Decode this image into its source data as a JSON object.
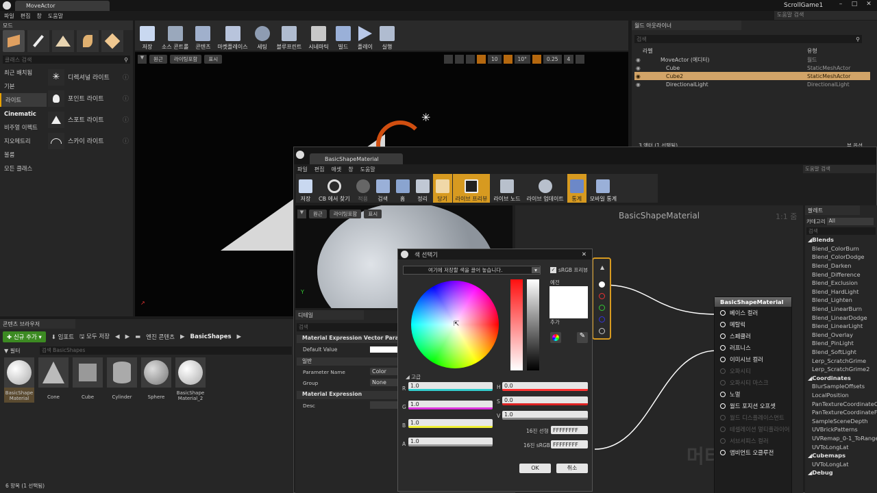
{
  "main": {
    "tab": "MoveActor",
    "project": "ScrollGame1",
    "help_search": "도움말 검색",
    "menu": [
      "파일",
      "편집",
      "창",
      "도움말"
    ],
    "toolbar": [
      "저장",
      "소스 콘트롤",
      "콘텐츠",
      "마켓플레이스",
      "세팅",
      "블루프린트",
      "시네마틱",
      "빌드",
      "플레이",
      "실행"
    ],
    "viewport_buttons": [
      "원근",
      "라이팅포함",
      "표시"
    ],
    "snap": {
      "grid": "10",
      "rot": "10°",
      "scale": "0.25",
      "cam": "4"
    }
  },
  "modes": {
    "title": "모드",
    "search_placeholder": "클래스 검색",
    "categories": [
      "최근 배치됨",
      "기본",
      "라이트",
      "Cinematic",
      "비주얼 이펙트",
      "지오메트리",
      "볼륨",
      "모든 클래스"
    ],
    "items": [
      "디렉셔널 라이트",
      "포인트 라이트",
      "스포트 라이트",
      "스카이 라이트"
    ]
  },
  "outliner": {
    "title": "월드 아웃라이너",
    "search_placeholder": "검색",
    "col_label": "라벨",
    "col_type": "유형",
    "rows": [
      {
        "label": "MoveActor (에디터)",
        "type": "월드"
      },
      {
        "label": "Cube",
        "type": "StaticMeshActor"
      },
      {
        "label": "Cube2",
        "type": "StaticMeshActor"
      },
      {
        "label": "DirectionalLight",
        "type": "DirectionalLight"
      }
    ],
    "footer": "3 액터 (1 선택됨)",
    "view_options": "뷰 옵션"
  },
  "content": {
    "title": "콘텐츠 브라우저",
    "add_new": "신규 추가",
    "import": "임포트",
    "save_all": "모두 저장",
    "path": [
      "엔진 콘텐츠",
      "BasicShapes"
    ],
    "filter": "필터",
    "search_placeholder": "검색 BasicShapes",
    "assets": [
      "BasicShape Material",
      "Cone",
      "Cube",
      "Cylinder",
      "Sphere",
      "BasicShape Material_2"
    ],
    "footer": "6 항목 (1 선택됨)"
  },
  "material": {
    "tab": "BasicShapeMaterial",
    "help_search": "도움말 검색",
    "menu": [
      "파일",
      "편집",
      "애셋",
      "창",
      "도움말"
    ],
    "toolbar": [
      "저장",
      "CB 에서 찾기",
      "적용",
      "검색",
      "홈",
      "정리",
      "당기",
      "라이브 프리뷰",
      "라이브 노드",
      "라이브 업데이트",
      "통계",
      "모바일 통계"
    ],
    "preview_buttons": [
      "원근",
      "라이팅포함",
      "표시"
    ],
    "graph_title": "BasicShapeMaterial",
    "zoom": "1:1 줌",
    "watermark": "머티리얼",
    "node_title": "BasicShapeMaterial",
    "pins": [
      {
        "label": "베이스 컬러",
        "on": true
      },
      {
        "label": "메탈릭",
        "on": true
      },
      {
        "label": "스페큘러",
        "on": true
      },
      {
        "label": "러프니스",
        "on": true
      },
      {
        "label": "이미시브 컬러",
        "on": true
      },
      {
        "label": "오파시티",
        "on": false
      },
      {
        "label": "오파시티 마스크",
        "on": false
      },
      {
        "label": "노멀",
        "on": true
      },
      {
        "label": "월드 포지션 오프셋",
        "on": true
      },
      {
        "label": "월드 디스플레이스먼트",
        "on": false
      },
      {
        "label": "테셀레이션 멀티플라이어",
        "on": false
      },
      {
        "label": "서브서피스 컬러",
        "on": false
      },
      {
        "label": "앰비언트 오클루전",
        "on": true
      }
    ]
  },
  "details": {
    "tab": "디테일",
    "search_placeholder": "검색",
    "section1": "Material Expression Vector Paramet",
    "default_value": "Default Value",
    "general": "일반",
    "param_name_label": "Parameter Name",
    "param_name": "Color",
    "group_label": "Group",
    "group": "None",
    "section2": "Material Expression",
    "desc": "Desc"
  },
  "palette": {
    "title": "팔레트",
    "category_label": "카테고리",
    "category": "All",
    "search_placeholder": "검색",
    "items": [
      {
        "t": "Blends",
        "h": true
      },
      {
        "t": "Blend_ColorBurn"
      },
      {
        "t": "Blend_ColorDodge"
      },
      {
        "t": "Blend_Darken"
      },
      {
        "t": "Blend_Difference"
      },
      {
        "t": "Blend_Exclusion"
      },
      {
        "t": "Blend_HardLight"
      },
      {
        "t": "Blend_Lighten"
      },
      {
        "t": "Blend_LinearBurn"
      },
      {
        "t": "Blend_LinearDodge"
      },
      {
        "t": "Blend_LinearLight"
      },
      {
        "t": "Blend_Overlay"
      },
      {
        "t": "Blend_PinLight"
      },
      {
        "t": "Blend_SoftLight"
      },
      {
        "t": "Lerp_ScratchGrime"
      },
      {
        "t": "Lerp_ScratchGrime2"
      },
      {
        "t": "Coordinates",
        "h": true
      },
      {
        "t": "BlurSampleOffsets"
      },
      {
        "t": "LocalPosition"
      },
      {
        "t": "PanTextureCoordinateCh"
      },
      {
        "t": "PanTextureCoordinateFr"
      },
      {
        "t": "SampleSceneDepth"
      },
      {
        "t": "UVBrickPatterns"
      },
      {
        "t": "UVRemap_0-1_ToRange"
      },
      {
        "t": "UVToLongLat"
      },
      {
        "t": "Cubemaps",
        "h": true
      },
      {
        "t": "UVToLongLat"
      },
      {
        "t": "Debug",
        "h": true
      }
    ]
  },
  "picker": {
    "title": "색 선택기",
    "swatch_hint": "여기에 저장할 색을 끌어 놓습니다.",
    "srgb": "sRGB 프리뷰",
    "old_label": "예전",
    "new_label": "추가",
    "advanced": "고급",
    "r_label": "R",
    "r": "1.0",
    "g_label": "G",
    "g": "1.0",
    "b_label": "B",
    "b": "1.0",
    "a_label": "A",
    "a": "1.0",
    "h_label": "H",
    "h": "0.0",
    "s_label": "S",
    "s": "0.0",
    "v_label": "V",
    "v": "1.0",
    "hex_linear_label": "16진 선형",
    "hex_linear": "FFFFFFFF",
    "hex_srgb_label": "16진 sRGB",
    "hex_srgb": "FFFFFFFF",
    "ok": "OK",
    "cancel": "취소",
    "selected_color": "#ffffff"
  }
}
